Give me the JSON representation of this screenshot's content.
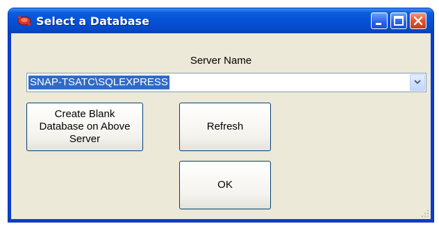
{
  "window": {
    "title": "Select a Database",
    "icon": "database-app-icon",
    "controls": [
      "minimize-icon",
      "maximize-icon",
      "close-icon"
    ]
  },
  "form": {
    "server_label": "Server Name",
    "server_value": "SNAP-TSATC\\SQLEXPRESS",
    "server_dropdown_icon": "chevron-down-icon"
  },
  "buttons": {
    "create_blank": "Create Blank Database on Above Server",
    "refresh": "Refresh",
    "ok": "OK"
  },
  "colors": {
    "titlebar": "#0552d8",
    "client_bg": "#ece9d8",
    "selection": "#316ac5",
    "close_button": "#e2552d"
  }
}
